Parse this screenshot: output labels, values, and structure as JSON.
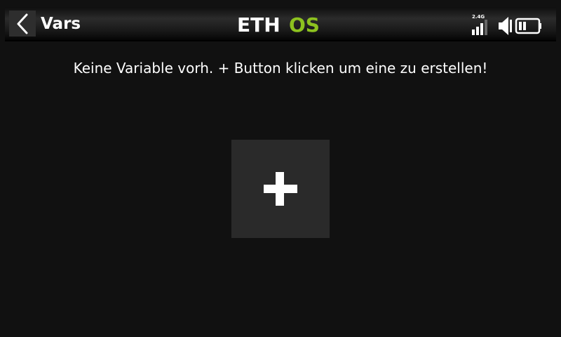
{
  "header": {
    "title": "Vars",
    "logo_text_part1": "ETH",
    "logo_text_part2": "OS",
    "logo_accent_color": "#8dc21f",
    "rf_band_label": "2.4G",
    "back_icon": "chevron-left-icon",
    "status_icons": [
      "rf-signal-icon",
      "speaker-icon",
      "battery-icon"
    ],
    "signal_bars": 3,
    "signal_bars_total": 4
  },
  "main": {
    "empty_message": "Keine Variable vorh. + Button klicken um eine zu erstellen!",
    "add_button_icon": "plus-icon"
  }
}
